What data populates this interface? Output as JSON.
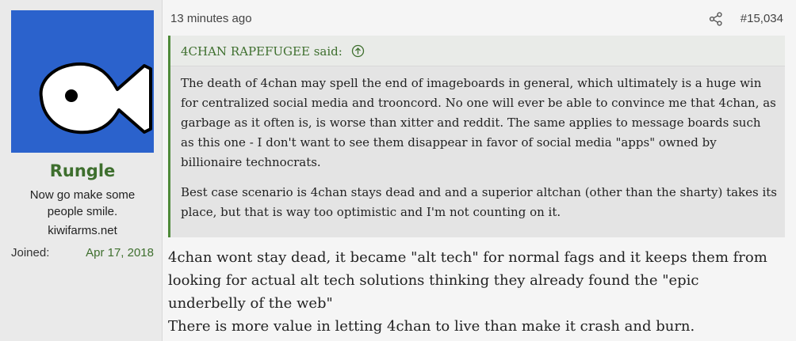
{
  "user": {
    "name": "Rungle",
    "title": "Now go make some people smile.",
    "title_lines": [
      "Now go make some",
      "people smile."
    ],
    "site": "kiwifarms.net",
    "joined_label": "Joined:",
    "joined_date": "Apr 17, 2018"
  },
  "post": {
    "time": "13 minutes ago",
    "number": "#15,034",
    "share_icon": "share-icon"
  },
  "quote": {
    "author": "4CHAN RAPEFUGEE said:",
    "paragraphs": [
      "The death of 4chan may spell the end of imageboards in general, which ultimately is a huge win for centralized social media and trooncord. No one will ever be able to convince me that 4chan, as garbage as it often is, is worse than xitter and reddit. The same applies to message boards such as this one - I don't want to see them disappear in favor of social media \"apps\" owned by billionaire technocrats.",
      "Best case scenario is 4chan stays dead and and a superior altchan (other than the sharty) takes its place, but that is way too optimistic and I'm not counting on it."
    ]
  },
  "reply": {
    "lines": [
      "4chan wont stay dead, it became \"alt tech\" for normal fags and it keeps them from",
      "looking for actual alt tech solutions thinking they already found the \"epic",
      "underbelly of the web\"",
      "There is more value in letting 4chan to live than make it crash and burn."
    ]
  },
  "colors": {
    "avatar_bg": "#2b62cc",
    "accent_green": "#3e6f2e",
    "quote_bar": "#4f8a3a"
  }
}
